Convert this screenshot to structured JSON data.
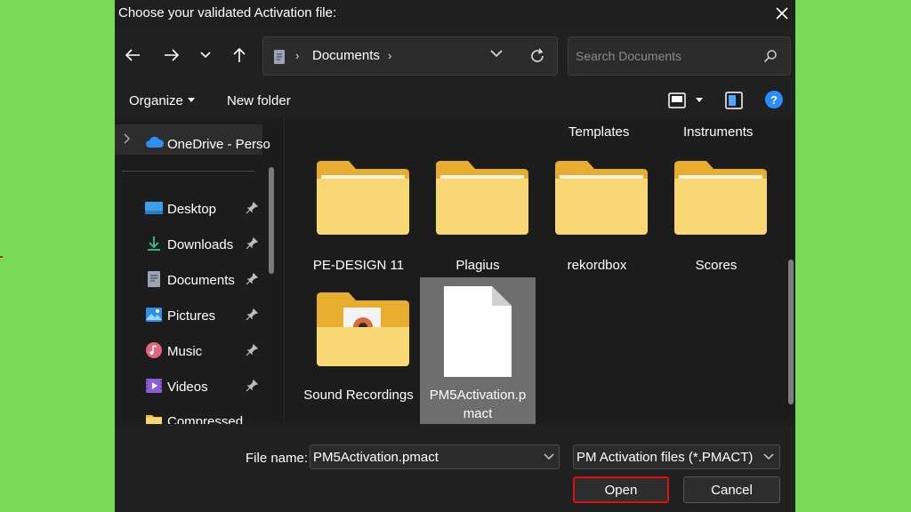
{
  "window": {
    "title": "Choose your validated Activation file:"
  },
  "address": {
    "crumb": "Documents",
    "separator": "›"
  },
  "search": {
    "placeholder": "Search Documents"
  },
  "toolbar": {
    "organize": "Organize",
    "new_folder": "New folder",
    "help": "?"
  },
  "sidebar": {
    "onedrive": "OneDrive - Perso",
    "items": [
      {
        "label": "Desktop",
        "icon": "desktop-icon",
        "pinned": true
      },
      {
        "label": "Downloads",
        "icon": "download-icon",
        "pinned": true
      },
      {
        "label": "Documents",
        "icon": "documents-icon",
        "pinned": true
      },
      {
        "label": "Pictures",
        "icon": "pictures-icon",
        "pinned": true
      },
      {
        "label": "Music",
        "icon": "music-icon",
        "pinned": true
      },
      {
        "label": "Videos",
        "icon": "videos-icon",
        "pinned": true
      },
      {
        "label": "Compressed",
        "icon": "folder-icon",
        "pinned": false
      }
    ]
  },
  "content": {
    "partial_top": [
      "Templates",
      "Instruments"
    ],
    "items": [
      {
        "label": "PE-DESIGN 11",
        "type": "folder"
      },
      {
        "label": "Plagius",
        "type": "folder"
      },
      {
        "label": "rekordbox",
        "type": "folder"
      },
      {
        "label": "Scores",
        "type": "folder"
      },
      {
        "label": "Sound Recordings",
        "type": "folder"
      },
      {
        "label": "PM5Activation.pmact",
        "type": "file",
        "selected": true
      }
    ]
  },
  "footer": {
    "filename_label": "File name:",
    "filename_value": "PM5Activation.pmact",
    "filetype_value": "PM Activation files (*.PMACT)",
    "open_label": "Open",
    "cancel_label": "Cancel"
  },
  "colors": {
    "background": "#78d957",
    "dialog": "#1c1c1c",
    "folder": "#f8d775",
    "accent": "#2a8cff",
    "highlight_border": "#e01010"
  }
}
